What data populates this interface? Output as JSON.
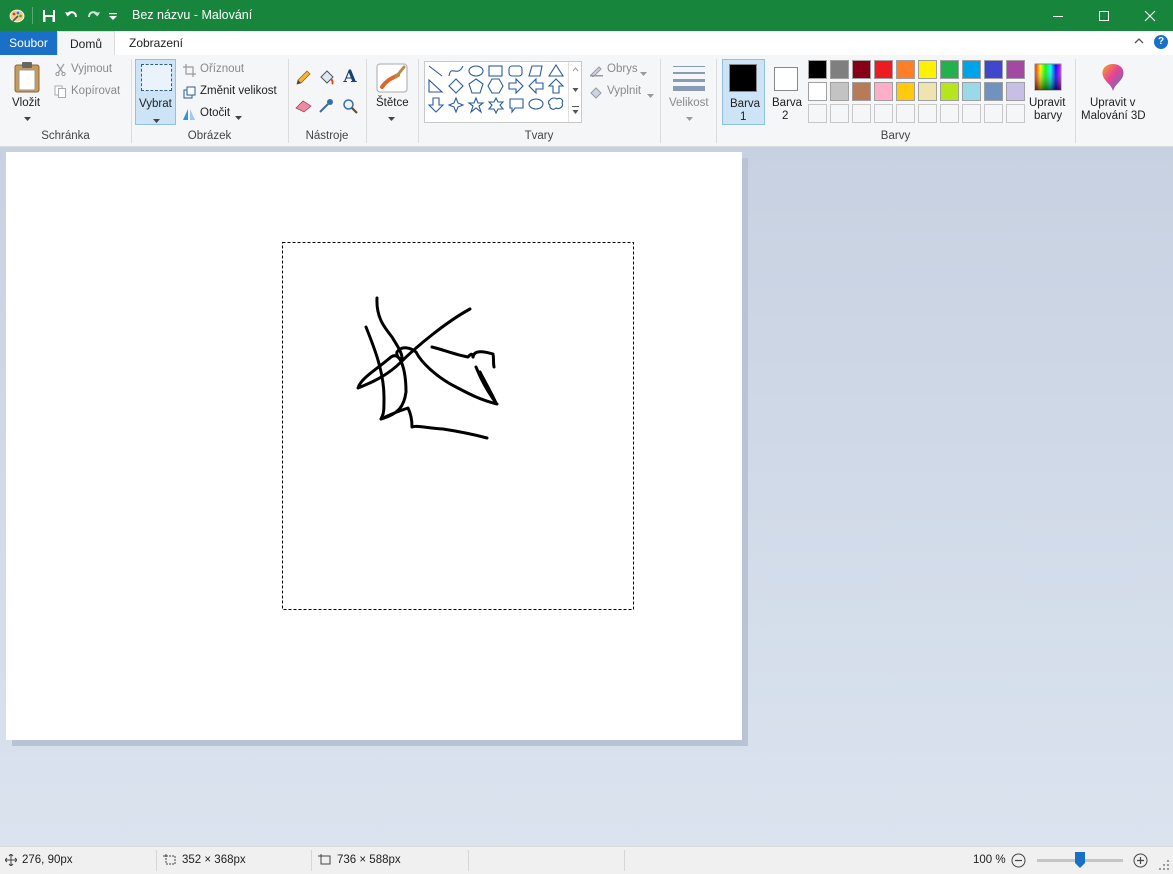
{
  "app": {
    "title": "Bez názvu - Malování"
  },
  "tabs": {
    "file": "Soubor",
    "home": "Domů",
    "view": "Zobrazení"
  },
  "clipboard": {
    "paste": "Vložit",
    "cut": "Vyjmout",
    "copy": "Kopírovat",
    "group": "Schránka"
  },
  "image": {
    "select": "Vybrat",
    "crop": "Oříznout",
    "resize": "Změnit velikost",
    "rotate": "Otočit",
    "group": "Obrázek"
  },
  "tools": {
    "group": "Nástroje",
    "text_glyph": "A"
  },
  "brushes": {
    "label": "Štětce"
  },
  "shapes": {
    "outline": "Obrys",
    "fill": "Vyplnit",
    "group": "Tvary"
  },
  "size": {
    "label": "Velikost"
  },
  "colors": {
    "color1_label": "Barva",
    "color1_num": "1",
    "color2_label": "Barva",
    "color2_num": "2",
    "color1": "#000000",
    "color2": "#ffffff",
    "edit_colors_1": "Upravit",
    "edit_colors_2": "barvy",
    "group": "Barvy",
    "palette_row1": [
      "#000000",
      "#7f7f7f",
      "#880015",
      "#ed1c24",
      "#ff7f27",
      "#fff200",
      "#22b14c",
      "#00a2e8",
      "#3f48cc",
      "#a349a4"
    ],
    "palette_row2": [
      "#ffffff",
      "#c3c3c3",
      "#b97a57",
      "#ffaec9",
      "#ffc90e",
      "#efe4b0",
      "#b5e61d",
      "#99d9ea",
      "#7092be",
      "#c8bfe7"
    ]
  },
  "paint3d": {
    "line1": "Upravit v",
    "line2": "Malování 3D"
  },
  "status": {
    "cursor_pos": "276, 90px",
    "selection_size": "352 × 368px",
    "canvas_size": "736 × 588px",
    "zoom": "100 %",
    "zoom_level": 100
  },
  "accent": {
    "titlebar": "#17853c",
    "file_tab": "#1a6fc6"
  }
}
